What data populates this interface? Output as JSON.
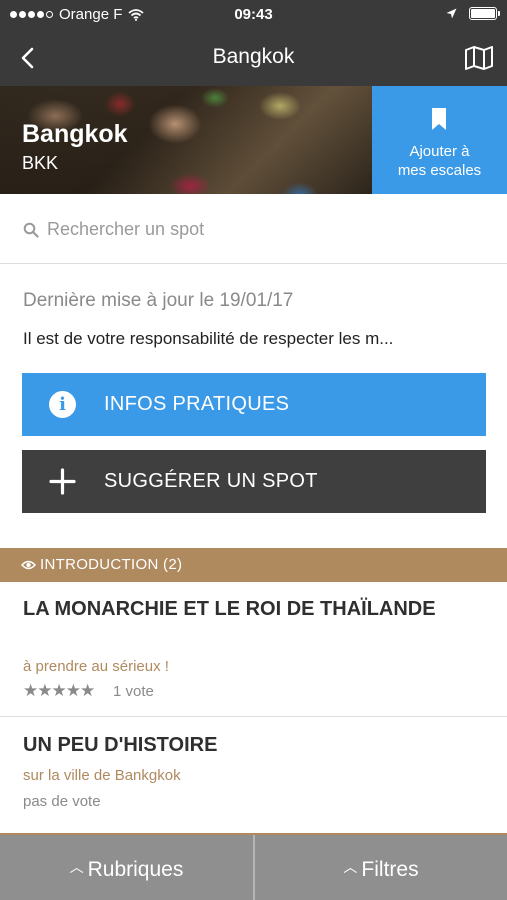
{
  "status_bar": {
    "carrier": "Orange F",
    "time": "09:43",
    "icons": [
      "signal-dots-icon",
      "wifi-icon",
      "location-arrow-icon",
      "battery-icon"
    ]
  },
  "nav": {
    "title": "Bangkok",
    "back_icon": "chevron-left-icon",
    "map_icon": "map-icon"
  },
  "hero": {
    "city": "Bangkok",
    "code": "BKK",
    "add_button": {
      "icon": "bookmark-icon",
      "label_line1": "Ajouter à",
      "label_line2": "mes escales"
    }
  },
  "search": {
    "placeholder": "Rechercher un spot",
    "value": ""
  },
  "info": {
    "updated": "Dernière mise à jour le 19/01/17",
    "disclaimer": "Il est de votre responsabilité de respecter les m..."
  },
  "buttons": {
    "infos_label": "INFOS PRATIQUES",
    "suggest_label": "SUGGÉRER UN SPOT"
  },
  "section": {
    "label": "INTRODUCTION (2)"
  },
  "items": [
    {
      "title": "LA MONARCHIE ET LE ROI DE THAÏLANDE",
      "subtitle": "à prendre au sérieux !",
      "stars": "★★★★★",
      "votes": "1 vote"
    },
    {
      "title": "UN PEU D'HISTOIRE",
      "subtitle": "sur la ville de Bankgkok",
      "votes": "pas de vote"
    }
  ],
  "bottom_bar": {
    "left_label": "Rubriques",
    "right_label": "Filtres"
  },
  "colors": {
    "dark": "#3a3a3a",
    "blue": "#3b9ae8",
    "gold": "#b08a5f",
    "bottom": "#8f8f8f"
  }
}
